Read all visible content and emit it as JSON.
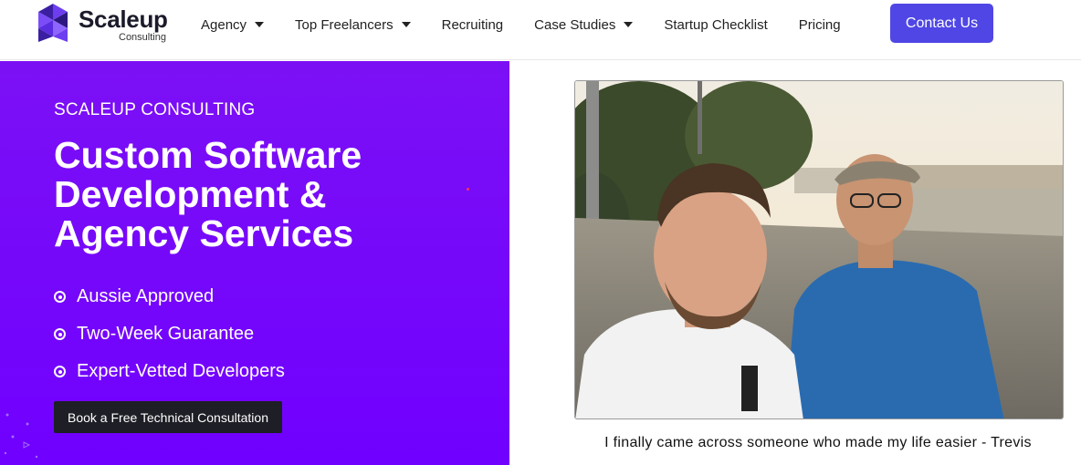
{
  "header": {
    "logo": {
      "name": "Scaleup",
      "subtitle": "Consulting"
    },
    "nav": [
      {
        "label": "Agency",
        "dropdown": true
      },
      {
        "label": "Top Freelancers",
        "dropdown": true
      },
      {
        "label": "Recruiting",
        "dropdown": false
      },
      {
        "label": "Case Studies",
        "dropdown": true
      },
      {
        "label": "Startup Checklist",
        "dropdown": false
      },
      {
        "label": "Pricing",
        "dropdown": false
      }
    ],
    "contact_label": "Contact Us"
  },
  "hero": {
    "eyebrow": "SCALEUP CONSULTING",
    "headline_lines": [
      "Custom Software",
      "Development &",
      "Agency Services"
    ],
    "features": [
      "Aussie Approved",
      "Two-Week Guarantee",
      "Expert-Vetted Developers"
    ],
    "cta_label": "Book a Free Technical Consultation"
  },
  "testimonial": {
    "caption": "I finally came across someone who made my life easier - Trevis"
  },
  "colors": {
    "brand_purple": "#7000ff",
    "contact_button": "#4f46e5",
    "cta_button": "#1e1e26"
  }
}
